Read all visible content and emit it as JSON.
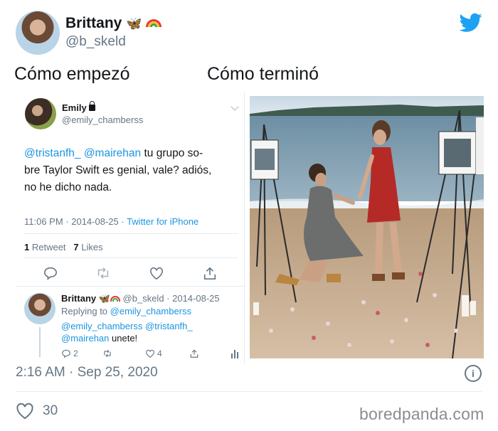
{
  "author": {
    "display_name": "Brittany",
    "emoji_1": "🦋",
    "handle": "@b_skeld"
  },
  "labels": {
    "left": "Cómo empezó",
    "right": "Cómo terminó"
  },
  "embedded_tweet": {
    "name": "Emily",
    "handle": "@emily_chamberss",
    "mention_1": "@tristanfh_",
    "mention_2": "@mairehan",
    "text_1": " tu grupo so-",
    "text_2": "bre Taylor Swift es genial, vale? adiós,",
    "text_3": "no he dicho nada.",
    "time": "11:06 PM · 2014-08-25 · ",
    "source": "Twitter for iPhone",
    "retweets": "1",
    "retweets_label": " Retweet",
    "likes": "7",
    "likes_label": " Likes"
  },
  "reply": {
    "name": "Brittany",
    "handle_date": " @b_skeld · 2014-08-25",
    "replying_prefix": "Replying to ",
    "replying_to": "@emily_chamberss",
    "mentions_line_1": "@emily_chamberss @tristanfh_",
    "mentions_line_2": "@mairehan",
    "text": " unete!",
    "reply_count": "2",
    "like_count": "4"
  },
  "footer": {
    "timestamp": "2:16 AM · Sep 25, 2020",
    "info": "i",
    "like_count": "30",
    "watermark": "boredpanda.com"
  },
  "colors": {
    "accent": "#1b95e0",
    "twitter_blue": "#1da1f2",
    "muted": "#657786"
  }
}
